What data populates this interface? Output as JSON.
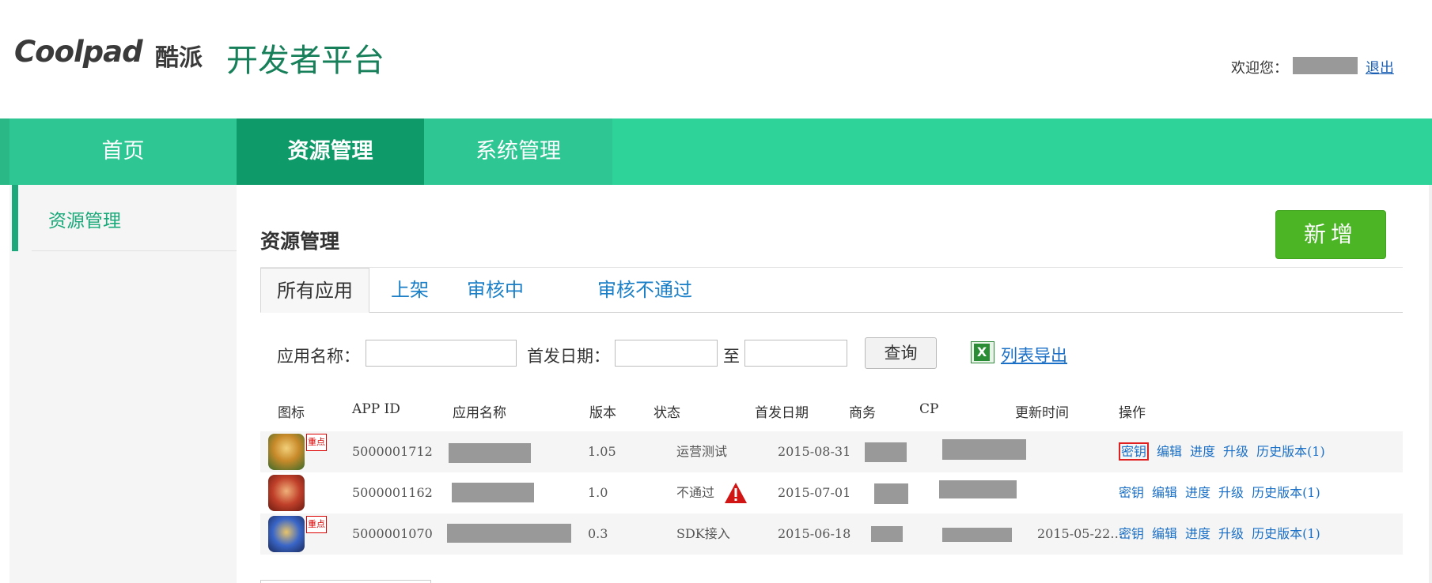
{
  "header": {
    "logo_text": "Coolpad",
    "logo_cn": "酷派",
    "platform_title": "开发者平台",
    "welcome_text": "欢迎您：",
    "logout_label": "退出"
  },
  "nav": {
    "items": [
      {
        "label": "首页"
      },
      {
        "label": "资源管理"
      },
      {
        "label": "系统管理"
      }
    ]
  },
  "sidebar": {
    "items": [
      {
        "label": "资源管理"
      }
    ]
  },
  "main": {
    "title": "资源管理",
    "add_button": "新增",
    "tabs": [
      {
        "label": "所有应用"
      },
      {
        "label": "上架"
      },
      {
        "label": "审核中"
      },
      {
        "label": "审核不通过"
      }
    ],
    "filters": {
      "app_name_label": "应用名称：",
      "release_date_label": "首发日期：",
      "to_label": "至",
      "query_button": "查询",
      "export_link": "列表导出"
    },
    "table": {
      "headers": [
        "图标",
        "APP ID",
        "应用名称",
        "版本",
        "状态",
        "首发日期",
        "商务",
        "CP",
        "更新时间",
        "操作"
      ],
      "rows": [
        {
          "badge": "重点",
          "app_id": "5000001712",
          "version": "1.05",
          "status": "运营测试",
          "release_date": "2015-08-31",
          "update_time": ""
        },
        {
          "badge": "",
          "app_id": "5000001162",
          "version": "1.0",
          "status": "不通过",
          "release_date": "2015-07-01",
          "update_time": ""
        },
        {
          "badge": "重点",
          "app_id": "5000001070",
          "version": "0.3",
          "status": "SDK接入",
          "release_date": "2015-06-18",
          "update_time": "2015-05-22…"
        }
      ],
      "actions": {
        "key": "密钥",
        "edit": "编辑",
        "progress": "进度",
        "upgrade": "升级",
        "history": "历史版本(1)"
      }
    }
  },
  "colors": {
    "nav_green": "#2ed399",
    "nav_active": "#0f9a6a",
    "add_button_green": "#4bb526",
    "link_blue": "#1a6fc7"
  }
}
